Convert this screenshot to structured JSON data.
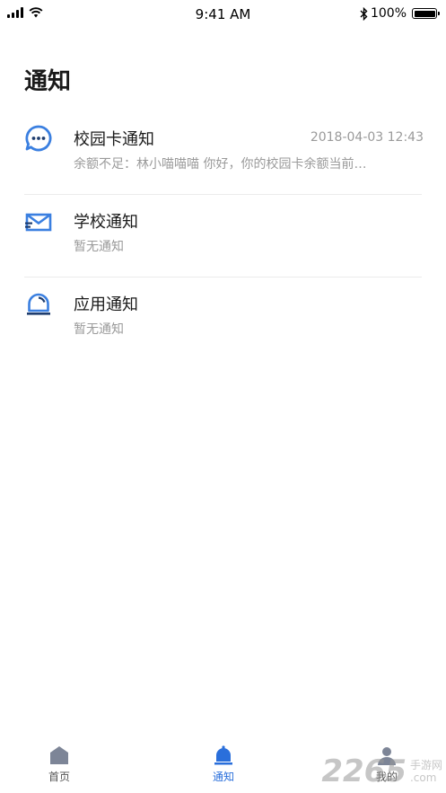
{
  "status_bar": {
    "time": "9:41 AM",
    "battery": "100%"
  },
  "page_title": "通知",
  "notifications": [
    {
      "title": "校园卡通知",
      "time": "2018-04-03 12:43",
      "preview": "余额不足：林小喵喵喵 你好，你的校园卡余额当前…",
      "icon": "chat-bubble-icon"
    },
    {
      "title": "学校通知",
      "time": "",
      "preview": "暂无通知",
      "icon": "envelope-icon"
    },
    {
      "title": "应用通知",
      "time": "",
      "preview": "暂无通知",
      "icon": "bell-icon"
    }
  ],
  "tabs": [
    {
      "label": "首页",
      "icon": "home-icon",
      "active": false
    },
    {
      "label": "通知",
      "icon": "bell-icon",
      "active": true
    },
    {
      "label": "我的",
      "icon": "profile-icon",
      "active": false
    }
  ],
  "watermark": {
    "number": "2265",
    "text_line1": "手游网",
    "text_line2": ".com"
  },
  "colors": {
    "accent": "#2a6fdb",
    "icon_blue": "#3a7fe0",
    "muted_text": "#9a9a9a",
    "tab_inactive_icon": "#7d8597"
  }
}
